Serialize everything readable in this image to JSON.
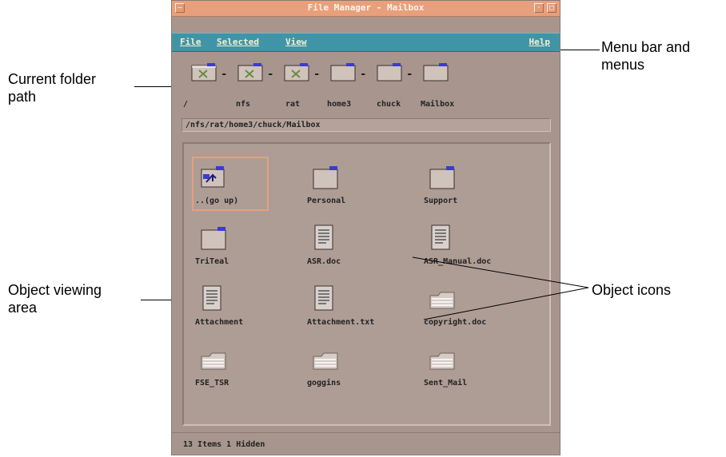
{
  "window": {
    "title": "File Manager - Mailbox"
  },
  "menubar": {
    "file": "File",
    "selected": "Selected",
    "view": "View",
    "help": "Help"
  },
  "path": {
    "segments": [
      "/",
      "nfs",
      "rat",
      "home3",
      "chuck",
      "Mailbox"
    ],
    "field": "/nfs/rat/home3/chuck/Mailbox"
  },
  "objects": [
    {
      "label": "..(go up)",
      "icon": "go-up-folder-icon"
    },
    {
      "label": "Personal",
      "icon": "folder-icon"
    },
    {
      "label": "Support",
      "icon": "folder-icon"
    },
    {
      "label": "TriTeal",
      "icon": "folder-icon"
    },
    {
      "label": "ASR.doc",
      "icon": "document-icon"
    },
    {
      "label": "ASR_Manual.doc",
      "icon": "document-icon"
    },
    {
      "label": "Attachment",
      "icon": "document-icon"
    },
    {
      "label": "Attachment.txt",
      "icon": "document-icon"
    },
    {
      "label": "copyright.doc",
      "icon": "mail-file-icon"
    },
    {
      "label": "FSE_TSR",
      "icon": "mail-file-icon"
    },
    {
      "label": "goggins",
      "icon": "mail-file-icon"
    },
    {
      "label": "Sent_Mail",
      "icon": "mail-file-icon"
    }
  ],
  "status": {
    "text": "13 Items 1 Hidden"
  },
  "callouts": {
    "menu_bar": [
      "Menu bar and",
      "menus"
    ],
    "current_folder": [
      "Current folder",
      "path"
    ],
    "object_viewing": [
      "Object viewing",
      "area"
    ],
    "object_icons": "Object icons"
  },
  "colors": {
    "titlebar": "#e8a07c",
    "menubar": "#3f95a6",
    "window_bg": "#a8968e"
  }
}
